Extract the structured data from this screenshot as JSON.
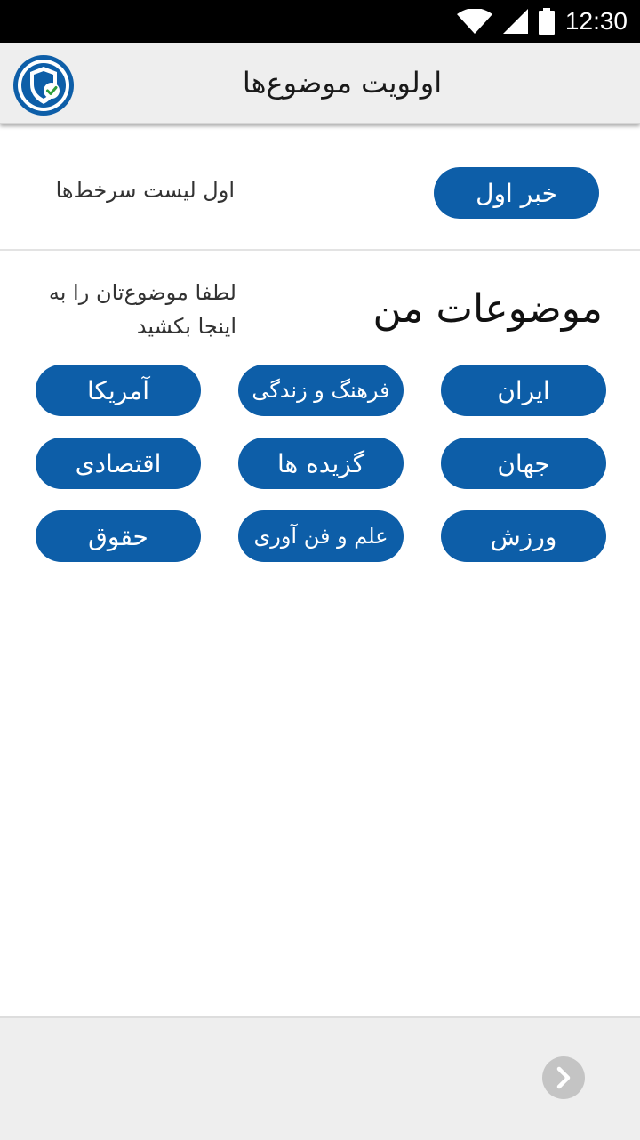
{
  "status_bar": {
    "time": "12:30"
  },
  "header": {
    "title": "اولویت موضوع‌ها"
  },
  "first_news": {
    "button_label": "خبر اول",
    "description": "اول لیست سرخط‌ها"
  },
  "my_topics": {
    "title": "موضوعات من",
    "hint": "لطفا موضوع‌تان را به اینجا بکشید"
  },
  "topics": [
    {
      "label": "ایران"
    },
    {
      "label": "فرهنگ و زندگی"
    },
    {
      "label": "آمریکا"
    },
    {
      "label": "جهان"
    },
    {
      "label": "گزیده ها"
    },
    {
      "label": "اقتصادی"
    },
    {
      "label": "ورزش"
    },
    {
      "label": "علم و فن آوری"
    },
    {
      "label": "حقوق"
    }
  ],
  "colors": {
    "accent": "#0d5ea8",
    "app_bar": "#eeeeee",
    "status_bar": "#000000"
  },
  "icons": {
    "logo": "shield-check-icon",
    "next": "chevron-right-icon",
    "wifi": "wifi-icon",
    "signal": "cell-signal-icon",
    "battery": "battery-icon"
  }
}
